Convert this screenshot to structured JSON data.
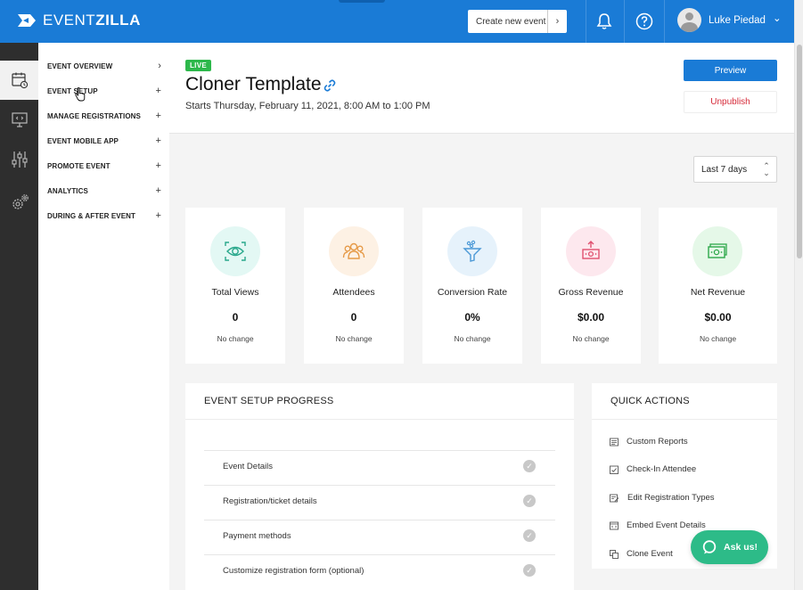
{
  "app": {
    "logo_text_light": "EVENT",
    "logo_text_bold": "ZILLA",
    "create_event_label": "Create new event",
    "create_event_chevron": "›",
    "notification_icon": "bell-icon",
    "help_icon": "question-icon",
    "user_name": "Luke Piedad",
    "user_menu_chevron": "⌄",
    "brand_color": "#1a7bd6"
  },
  "rail": {
    "items": [
      "calendar-clock-icon",
      "presentation-code-icon",
      "sliders-icon",
      "gears-icon"
    ]
  },
  "nav": {
    "items": [
      {
        "label": "EVENT OVERVIEW",
        "sign": "›"
      },
      {
        "label": "EVENT SETUP",
        "sign": "+"
      },
      {
        "label": "MANAGE REGISTRATIONS",
        "sign": "+"
      },
      {
        "label": "EVENT MOBILE APP",
        "sign": "+"
      },
      {
        "label": "PROMOTE EVENT",
        "sign": "+"
      },
      {
        "label": "ANALYTICS",
        "sign": "+"
      },
      {
        "label": "DURING & AFTER EVENT",
        "sign": "+"
      }
    ]
  },
  "event": {
    "status_badge": "LIVE",
    "title": "Cloner Template",
    "dates": "Starts Thursday, February 11, 2021, 8:00 AM to 1:00 PM",
    "preview_label": "Preview",
    "unpublish_label": "Unpublish"
  },
  "range_select": {
    "value": "Last 7 days"
  },
  "stats": [
    {
      "label": "Total Views",
      "value": "0",
      "change": "No change",
      "icon": "eye-scan-icon",
      "bg": "#e3f8f4",
      "color": "#2aa88c"
    },
    {
      "label": "Attendees",
      "value": "0",
      "change": "No change",
      "icon": "people-group-icon",
      "bg": "#fdf1e4",
      "color": "#e69a47"
    },
    {
      "label": "Conversion Rate",
      "value": "0%",
      "change": "No change",
      "icon": "funnel-icon",
      "bg": "#e6f2fb",
      "color": "#4a98d6"
    },
    {
      "label": "Gross Revenue",
      "value": "$0.00",
      "change": "No change",
      "icon": "money-up-icon",
      "bg": "#fde8ee",
      "color": "#e0506f"
    },
    {
      "label": "Net Revenue",
      "value": "$0.00",
      "change": "No change",
      "icon": "money-bill-icon",
      "bg": "#e5f8e8",
      "color": "#2ea84a"
    }
  ],
  "progress": {
    "title": "EVENT SETUP PROGRESS",
    "items": [
      {
        "label": "Event Details",
        "done": true
      },
      {
        "label": "Registration/ticket details",
        "done": true
      },
      {
        "label": "Payment methods",
        "done": true
      },
      {
        "label": "Customize registration form (optional)",
        "done": true
      }
    ]
  },
  "quick_actions": {
    "title": "QUICK ACTIONS",
    "items": [
      {
        "label": "Custom Reports",
        "icon": "report-icon"
      },
      {
        "label": "Check-In Attendee",
        "icon": "checkin-icon"
      },
      {
        "label": "Edit Registration Types",
        "icon": "edit-list-icon"
      },
      {
        "label": "Embed Event Details",
        "icon": "embed-icon"
      },
      {
        "label": "Clone Event",
        "icon": "clone-icon"
      }
    ]
  },
  "support": {
    "ask_label": "Ask us!"
  }
}
